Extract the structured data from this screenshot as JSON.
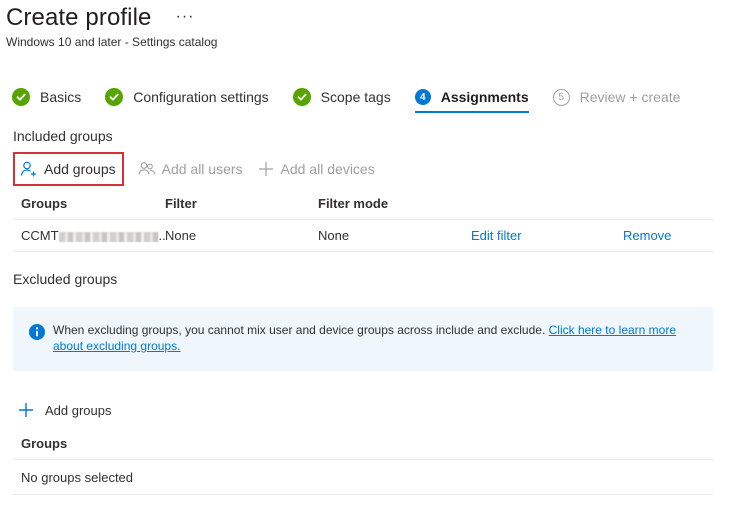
{
  "header": {
    "title": "Create profile",
    "more": "···",
    "subtitle": "Windows 10 and later - Settings catalog"
  },
  "steps": [
    {
      "label": "Basics",
      "state": "complete"
    },
    {
      "label": "Configuration settings",
      "state": "complete"
    },
    {
      "label": "Scope tags",
      "state": "complete"
    },
    {
      "label": "Assignments",
      "number": "4",
      "state": "active"
    },
    {
      "label": "Review + create",
      "number": "5",
      "state": "disabled"
    }
  ],
  "included": {
    "title": "Included groups",
    "commands": {
      "add_groups": "Add groups",
      "add_all_users": "Add all users",
      "add_all_devices": "Add all devices"
    },
    "columns": [
      "Groups",
      "Filter",
      "Filter mode"
    ],
    "row": {
      "group": "CCMT",
      "group_suffix": "..",
      "filter": "None",
      "filter_mode": "None",
      "edit_filter": "Edit filter",
      "remove": "Remove"
    }
  },
  "excluded": {
    "title": "Excluded groups",
    "info_text": "When excluding groups, you cannot mix user and device groups across include and exclude. ",
    "info_link": "Click here to learn more about excluding groups.",
    "add_groups": "Add groups",
    "column": "Groups",
    "empty": "No groups selected"
  },
  "colors": {
    "accent": "#0078d4",
    "success": "#57a300",
    "highlight": "#d13438",
    "info_bg": "#eff6fc"
  }
}
